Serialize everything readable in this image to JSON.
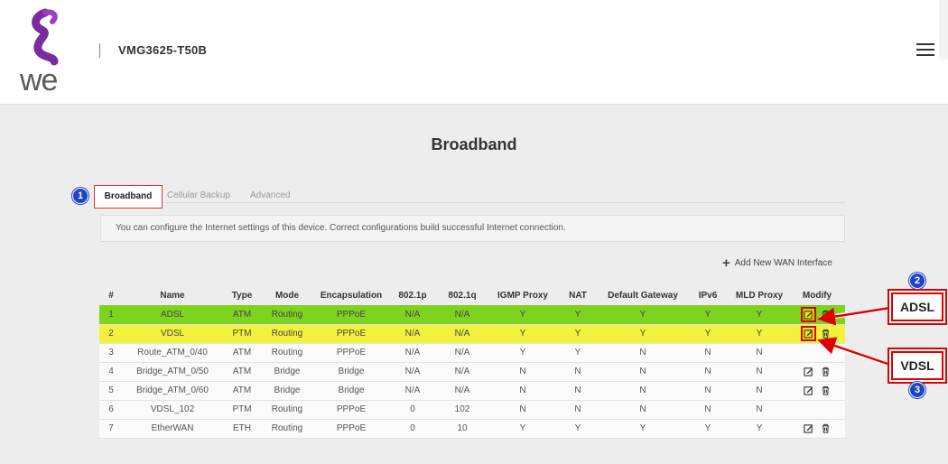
{
  "header": {
    "brand": "we",
    "model": "VMG3625-T50B"
  },
  "page_title": "Broadband",
  "tabs": [
    {
      "label": "Broadband"
    },
    {
      "label": "Cellular Backup"
    },
    {
      "label": "Advanced"
    }
  ],
  "info_text": "You can configure the Internet settings of this device. Correct configurations build successful Internet connection.",
  "add_wan_label": "Add New WAN Interface",
  "table": {
    "columns": [
      "#",
      "Name",
      "Type",
      "Mode",
      "Encapsulation",
      "802.1p",
      "802.1q",
      "IGMP Proxy",
      "NAT",
      "Default Gateway",
      "IPv6",
      "MLD Proxy",
      "Modify"
    ],
    "rows": [
      {
        "num": "1",
        "name": "ADSL",
        "type": "ATM",
        "mode": "Routing",
        "encap": "PPPoE",
        "p": "N/A",
        "q": "N/A",
        "igmp": "Y",
        "nat": "Y",
        "gw": "Y",
        "ipv6": "Y",
        "mld": "Y"
      },
      {
        "num": "2",
        "name": "VDSL",
        "type": "PTM",
        "mode": "Routing",
        "encap": "PPPoE",
        "p": "N/A",
        "q": "N/A",
        "igmp": "Y",
        "nat": "Y",
        "gw": "Y",
        "ipv6": "Y",
        "mld": "Y"
      },
      {
        "num": "3",
        "name": "Route_ATM_0/40",
        "type": "ATM",
        "mode": "Routing",
        "encap": "PPPoE",
        "p": "N/A",
        "q": "N/A",
        "igmp": "Y",
        "nat": "Y",
        "gw": "N",
        "ipv6": "N",
        "mld": "N"
      },
      {
        "num": "4",
        "name": "Bridge_ATM_0/50",
        "type": "ATM",
        "mode": "Bridge",
        "encap": "Bridge",
        "p": "N/A",
        "q": "N/A",
        "igmp": "N",
        "nat": "N",
        "gw": "N",
        "ipv6": "N",
        "mld": "N"
      },
      {
        "num": "5",
        "name": "Bridge_ATM_0/60",
        "type": "ATM",
        "mode": "Bridge",
        "encap": "Bridge",
        "p": "N/A",
        "q": "N/A",
        "igmp": "N",
        "nat": "N",
        "gw": "N",
        "ipv6": "N",
        "mld": "N"
      },
      {
        "num": "6",
        "name": "VDSL_102",
        "type": "PTM",
        "mode": "Routing",
        "encap": "PPPoE",
        "p": "0",
        "q": "102",
        "igmp": "N",
        "nat": "N",
        "gw": "N",
        "ipv6": "N",
        "mld": "N"
      },
      {
        "num": "7",
        "name": "EtherWAN",
        "type": "ETH",
        "mode": "Routing",
        "encap": "PPPoE",
        "p": "0",
        "q": "10",
        "igmp": "Y",
        "nat": "Y",
        "gw": "Y",
        "ipv6": "Y",
        "mld": "Y"
      }
    ]
  },
  "annotations": {
    "badges": [
      "1",
      "2",
      "3"
    ],
    "callout_adsl": "ADSL",
    "callout_vdsl": "VDSL"
  },
  "colors": {
    "highlight_green": "#7ed321",
    "highlight_yellow": "#f2f23c",
    "annotation_red": "#e00000",
    "badge_blue": "#1c44c4",
    "logo_purple": "#7a2c9e"
  },
  "icons": [
    "edit-icon",
    "trash-icon",
    "plus-icon",
    "hamburger-menu-icon"
  ]
}
